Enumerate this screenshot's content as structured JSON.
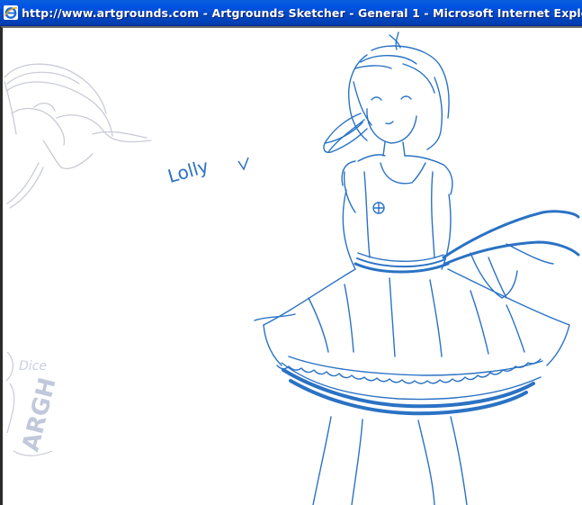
{
  "window": {
    "title": "http://www.artgrounds.com - Artgrounds Sketcher - General 1 - Microsoft Internet Explorer",
    "icon": "internet-explorer-icon"
  },
  "canvas": {
    "sketch_texts": {
      "signature": "Lolly",
      "faded_upper": "Dice",
      "faded_lower": "ARGH"
    },
    "colors": {
      "pen": "#2a72c4",
      "faded": "#c9cbd6",
      "canvas": "#ffffff",
      "titlebar": "#0054e3"
    }
  }
}
